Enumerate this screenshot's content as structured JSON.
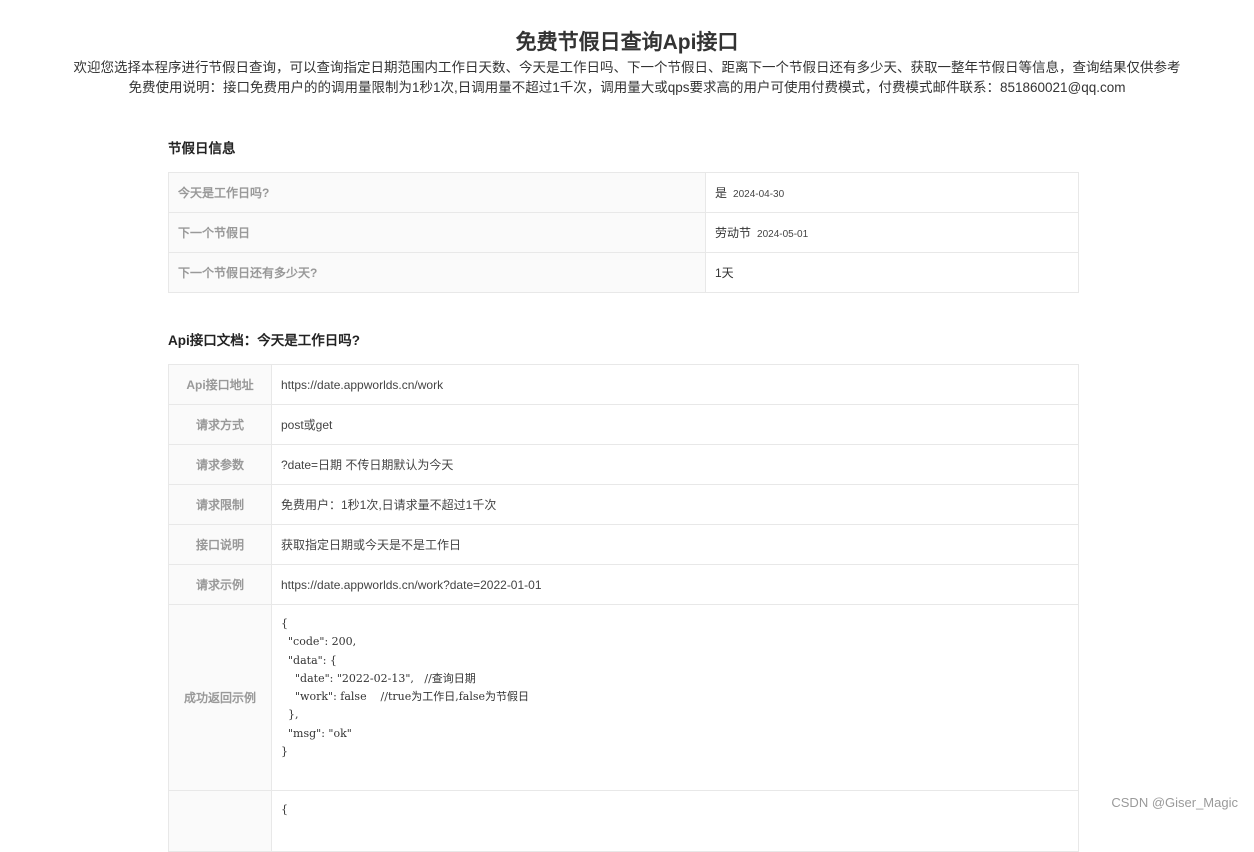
{
  "header": {
    "title": "免费节假日查询Api接口",
    "intro_line1": "欢迎您选择本程序进行节假日查询，可以查询指定日期范围内工作日天数、今天是工作日吗、下一个节假日、距离下一个节假日还有多少天、获取一整年节假日等信息，查询结果仅供参考",
    "intro_line2": "免费使用说明：接口免费用户的的调用量限制为1秒1次,日调用量不超过1千次，调用量大或qps要求高的用户可使用付费模式，付费模式邮件联系：851860021@qq.com"
  },
  "holiday_info": {
    "title": "节假日信息",
    "rows": [
      {
        "label": "今天是工作日吗?",
        "value": "是",
        "date": "2024-04-30"
      },
      {
        "label": "下一个节假日",
        "value": "劳动节",
        "date": "2024-05-01"
      },
      {
        "label": "下一个节假日还有多少天?",
        "value": "1天",
        "date": ""
      }
    ]
  },
  "api_doc": {
    "title": "Api接口文档：今天是工作日吗?",
    "rows": [
      {
        "label": "Api接口地址",
        "value": "https://date.appworlds.cn/work"
      },
      {
        "label": "请求方式",
        "value": "post或get"
      },
      {
        "label": "请求参数",
        "value": "?date=日期 不传日期默认为今天"
      },
      {
        "label": "请求限制",
        "value": "免费用户：1秒1次,日请求量不超过1千次"
      },
      {
        "label": "接口说明",
        "value": "获取指定日期或今天是不是工作日"
      },
      {
        "label": "请求示例",
        "value": "https://date.appworlds.cn/work?date=2022-01-01"
      }
    ],
    "success_label": "成功返回示例",
    "success_code": "{\n  \"code\": 200,\n  \"data\": {\n    \"date\": \"2022-02-13\",   //查询日期\n    \"work\": false    //true为工作日,false为节假日\n  },\n  \"msg\": \"ok\"\n}",
    "next_code": "{"
  },
  "watermark": "CSDN @Giser_Magic"
}
